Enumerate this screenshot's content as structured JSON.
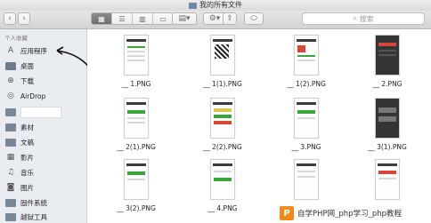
{
  "window": {
    "title": "我的所有文件"
  },
  "toolbar": {
    "search_placeholder": "搜索"
  },
  "sidebar": {
    "section_title": "个人收藏",
    "items": [
      {
        "label": "应用程序",
        "icon": "apps-icon"
      },
      {
        "label": "桌面",
        "icon": "desktop-icon"
      },
      {
        "label": "下载",
        "icon": "download-icon"
      },
      {
        "label": "AirDrop",
        "icon": "airdrop-icon"
      },
      {
        "label": "",
        "icon": "folder-icon"
      },
      {
        "label": "素材",
        "icon": "folder-icon"
      },
      {
        "label": "文稿",
        "icon": "documents-icon"
      },
      {
        "label": "影片",
        "icon": "movies-icon"
      },
      {
        "label": "音乐",
        "icon": "music-icon"
      },
      {
        "label": "图片",
        "icon": "pictures-icon"
      },
      {
        "label": "固件系统",
        "icon": "folder-icon"
      },
      {
        "label": "越狱工具",
        "icon": "folder-icon"
      }
    ]
  },
  "files": [
    {
      "name": "__ 1.PNG"
    },
    {
      "name": "__ 1(1).PNG"
    },
    {
      "name": "__ 1(2).PNG"
    },
    {
      "name": "__ 2.PNG"
    },
    {
      "name": "__ 2(1).PNG"
    },
    {
      "name": "__ 2(2).PNG"
    },
    {
      "name": "__ 3.PNG"
    },
    {
      "name": "__ 3(1).PNG"
    },
    {
      "name": "__ 3(2).PNG"
    },
    {
      "name": "__ 4.PNG"
    },
    {
      "name": ""
    },
    {
      "name": ""
    }
  ],
  "watermark": {
    "text": "自学PHP网_php学习_php教程",
    "logo": "P"
  }
}
